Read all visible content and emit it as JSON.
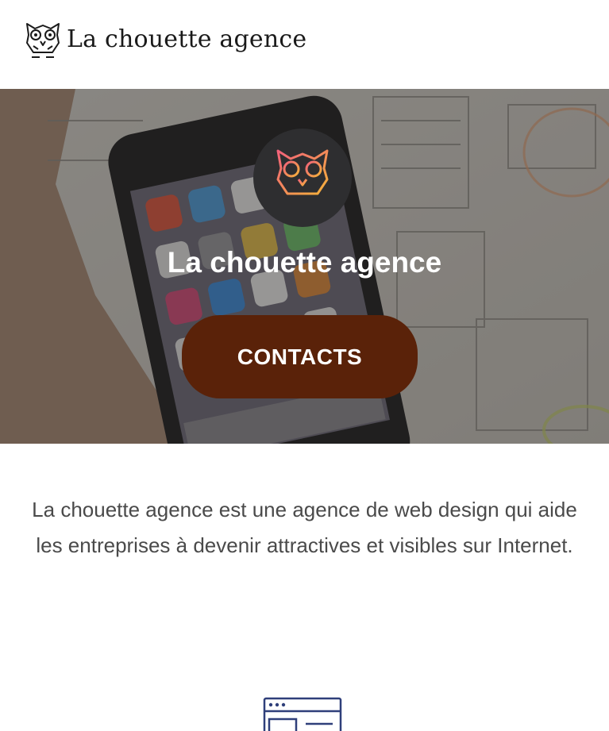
{
  "header": {
    "brand_name": "La chouette agence",
    "logo_icon": "owl-logo-icon"
  },
  "hero": {
    "badge_icon": "owl-badge-icon",
    "title": "La chouette agence",
    "cta_label": "CONTACTS",
    "colors": {
      "cta_bg": "#5a2209",
      "badge_bg": "#2e2e30"
    }
  },
  "intro": {
    "line1": "La chouette agence est une agence de web design qui aide",
    "line2": "les entreprises à devenir attractives et visibles sur Internet."
  },
  "features": {
    "icon": "browser-window-icon"
  }
}
